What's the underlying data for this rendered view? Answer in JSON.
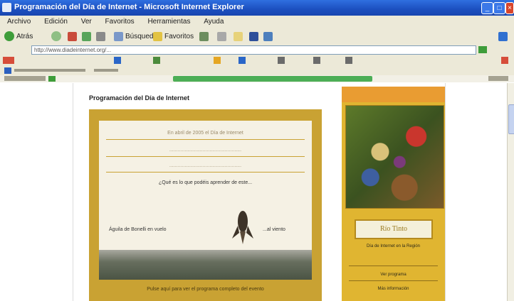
{
  "window": {
    "title": "Programación del Día de Internet - Microsoft Internet Explorer"
  },
  "menu": {
    "items": [
      "Archivo",
      "Edición",
      "Ver",
      "Favoritos",
      "Herramientas",
      "Ayuda"
    ]
  },
  "toolbar": {
    "back": "Atrás",
    "search": "Búsqueda",
    "favorites": "Favoritos"
  },
  "address": {
    "url": "http://www.diadeinternet.org/..."
  },
  "page": {
    "heading": "Programación del Día de Internet",
    "poster_lines": [
      "En abril de 2005 el Día de Internet",
      "....................................................",
      "....................................................",
      "¿Qué es lo que podéis aprender de este..."
    ],
    "poster_bottom_left": "Águila de Bonelli en vuelo",
    "poster_bottom_right": "...al viento",
    "poster_footer": "Pulse aquí para ver el programa completo del evento",
    "sidebar_logo": "Río Tinto",
    "sidebar_text1": "Día de Internet en la Región",
    "sidebar_text2": "Ver programa",
    "sidebar_text3": "Más información"
  },
  "colors": {
    "poster_gold": "#c9a233",
    "sidebar_yellow": "#e0b531",
    "xp_blue": "#1c4fbf"
  }
}
